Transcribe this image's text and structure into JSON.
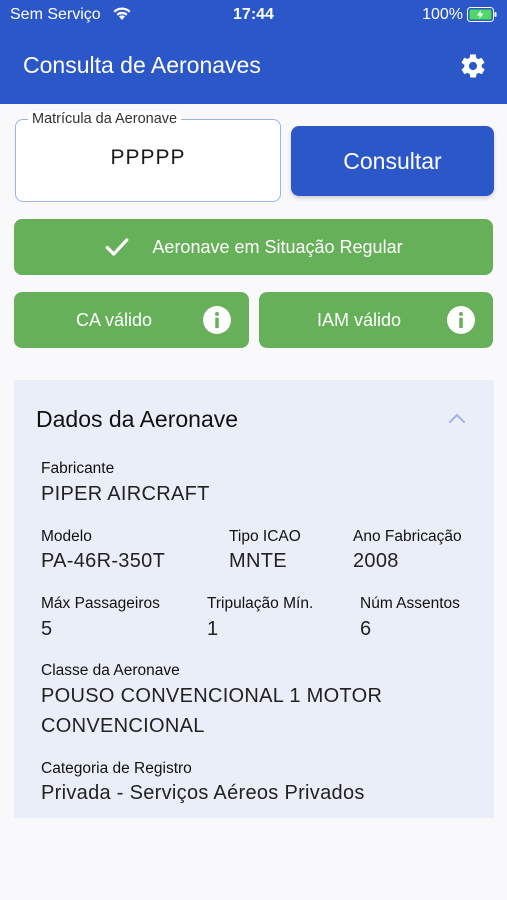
{
  "status_bar": {
    "carrier": "Sem Serviço",
    "time": "17:44",
    "battery": "100%"
  },
  "app_bar": {
    "title": "Consulta de Aeronaves",
    "settings_icon": "gear-icon"
  },
  "search": {
    "label": "Matrícula da Aeronave",
    "value": "PPPPP",
    "button_label": "Consultar"
  },
  "status": {
    "regular_label": "Aeronave em Situação Regular",
    "ca_label": "CA válido",
    "iam_label": "IAM válido"
  },
  "colors": {
    "primary": "#2b57c9",
    "success": "#66b05a",
    "card_bg": "#eaeef8"
  },
  "details": {
    "title": "Dados da Aeronave",
    "fabricante_label": "Fabricante",
    "fabricante_value": "PIPER AIRCRAFT",
    "modelo_label": "Modelo",
    "modelo_value": "PA-46R-350T",
    "tipo_icao_label": "Tipo ICAO",
    "tipo_icao_value": "MNTE",
    "ano_label": "Ano Fabricação",
    "ano_value": "2008",
    "max_pass_label": "Máx Passageiros",
    "max_pass_value": "5",
    "trip_label": "Tripulação Mín.",
    "trip_value": "1",
    "assentos_label": "Núm Assentos",
    "assentos_value": "6",
    "classe_label": "Classe da Aeronave",
    "classe_value_line1": "POUSO CONVENCIONAL 1 MOTOR",
    "classe_value_line2": "CONVENCIONAL",
    "categoria_label": "Categoria de Registro",
    "categoria_value": "Privada - Serviços Aéreos Privados"
  }
}
